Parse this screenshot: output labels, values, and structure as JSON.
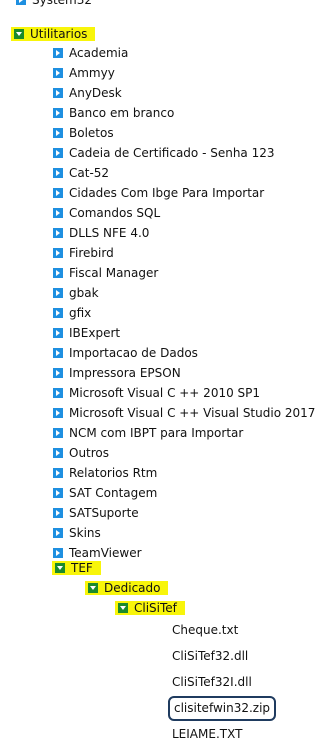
{
  "tree": {
    "top_cut_label": "System32",
    "utilitarios": "Utilitarios",
    "children": [
      "Academia",
      "Ammyy",
      "AnyDesk",
      "Banco em branco",
      "Boletos",
      "Cadeia de Certificado - Senha 123",
      "Cat-52",
      "Cidades Com Ibge Para Importar",
      "Comandos SQL",
      "DLLS NFE 4.0",
      "Firebird",
      "Fiscal Manager",
      "gbak",
      "gfix",
      "IBExpert",
      "Importacao de Dados",
      "Impressora EPSON",
      "Microsoft Visual C ++ 2010 SP1",
      "Microsoft Visual C ++ Visual Studio 2017",
      "NCM com IBPT para Importar",
      "Outros",
      "Relatorios Rtm",
      "SAT Contagem",
      "SATSuporte",
      "Skins",
      "TeamViewer"
    ],
    "tef": "TEF",
    "dedicado": "Dedicado",
    "clisitef": "CliSiTef",
    "files": [
      "Cheque.txt",
      "CliSiTef32.dll",
      "CliSiTef32I.dll",
      "clisitefwin32.zip",
      "LEIAME.TXT"
    ]
  },
  "colors": {
    "highlight": "#f8f50a",
    "collapsed_icon": "#1e8fe0",
    "expanded_icon": "#1b8a2c",
    "selected_outline": "#1f3b5f"
  }
}
